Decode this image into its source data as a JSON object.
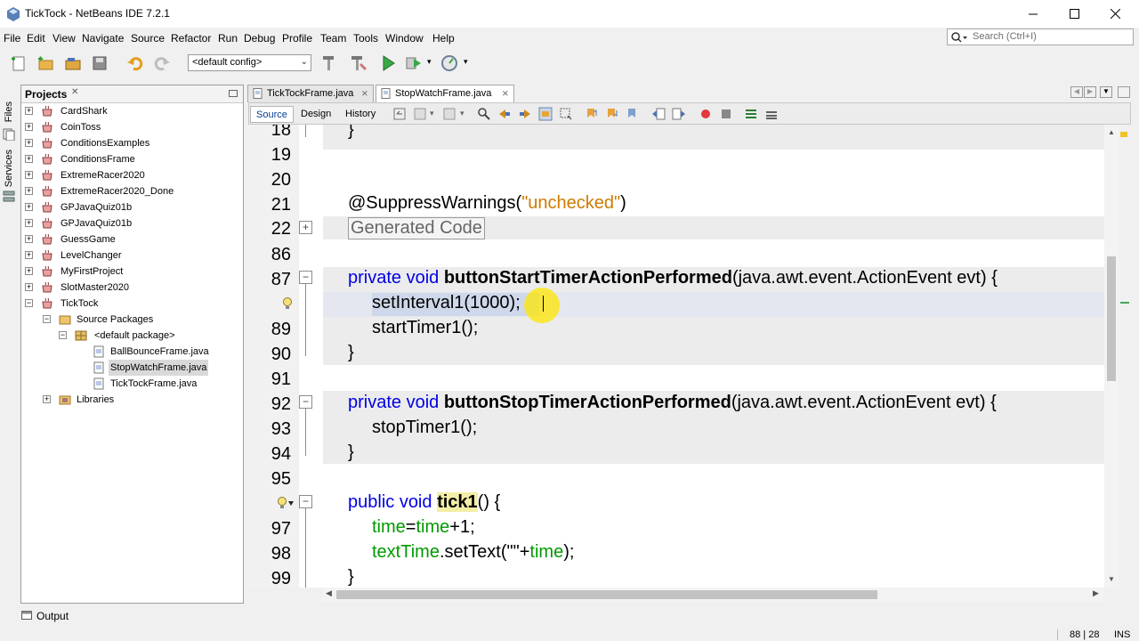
{
  "window": {
    "title": "TickTock - NetBeans IDE 7.2.1"
  },
  "menubar": {
    "items": [
      "File",
      "Edit",
      "View",
      "Navigate",
      "Source",
      "Refactor",
      "Run",
      "Debug",
      "Profile",
      "Team",
      "Tools",
      "Window",
      "Help"
    ]
  },
  "search": {
    "placeholder": "Search (Ctrl+I)"
  },
  "toolbar": {
    "config": "<default config>"
  },
  "sidestrip": {
    "files": "Files",
    "services": "Services"
  },
  "projects": {
    "title": "Projects",
    "items": [
      "CardShark",
      "CoinToss",
      "ConditionsExamples",
      "ConditionsFrame",
      "ExtremeRacer2020",
      "ExtremeRacer2020_Done",
      "GPJavaQuiz01b",
      "GPJavaQuiz01b",
      "GuessGame",
      "LevelChanger",
      "MyFirstProject",
      "SlotMaster2020",
      "TickTock"
    ],
    "source_packages": "Source Packages",
    "default_package": "<default package>",
    "files": [
      "BallBounceFrame.java",
      "StopWatchFrame.java",
      "TickTockFrame.java"
    ],
    "libraries": "Libraries"
  },
  "editor": {
    "tabs": [
      "TickTockFrame.java",
      "StopWatchFrame.java"
    ],
    "modes": [
      "Source",
      "Design",
      "History"
    ],
    "line_numbers": [
      "18",
      "19",
      "20",
      "21",
      "22",
      "86",
      "87",
      "88",
      "89",
      "90",
      "91",
      "92",
      "93",
      "94",
      "95",
      "97",
      "98",
      "99"
    ],
    "code": {
      "l18": "}",
      "annotation": "@SuppressWarnings(",
      "annotation_arg": "\"unchecked\"",
      "annotation_close": ")",
      "generated": "Generated Code",
      "kw_private_void": "private void",
      "method_start": "buttonStartTimerActionPerformed",
      "params": "(java.awt.event.ActionEvent evt) {",
      "set_interval": "setInterval1(1000);",
      "start_timer": "startTimer1();",
      "close_brace": "}",
      "method_stop": "buttonStopTimerActionPerformed",
      "stop_timer": "stopTimer1();",
      "kw_public_void": "public void",
      "tick": "tick1",
      "tick_rest": "() {",
      "time_field": "time",
      "time_eq": "=",
      "time_plus": "+1;",
      "text_time": "textTime",
      "set_text": ".setText(\"\"+",
      "set_text_close": ");"
    }
  },
  "output": {
    "label": "Output"
  },
  "status": {
    "position": "88 | 28",
    "mode": "INS"
  }
}
